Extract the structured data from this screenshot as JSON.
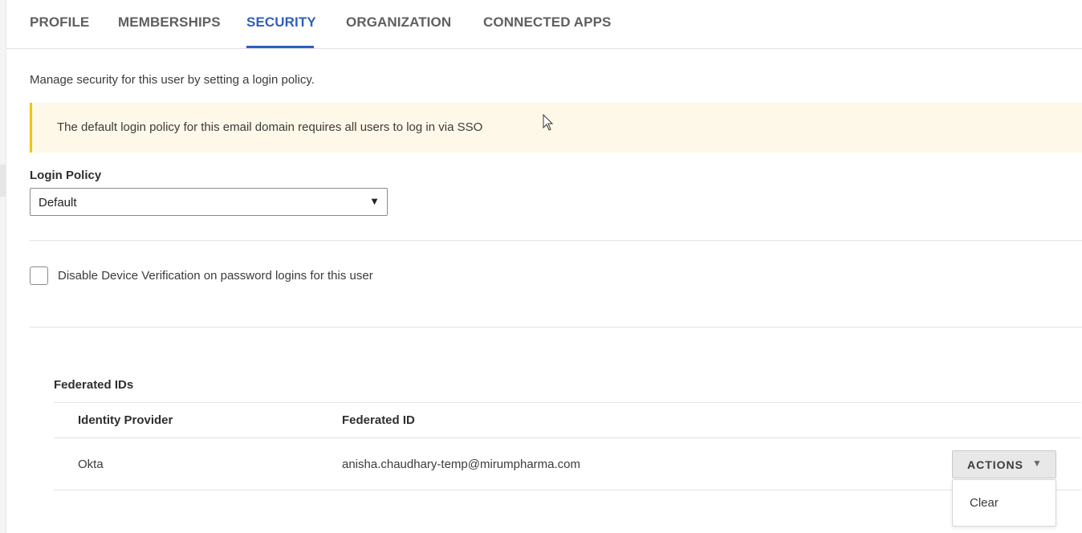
{
  "tabs": {
    "profile": "PROFILE",
    "memberships": "MEMBERSHIPS",
    "security": "SECURITY",
    "organization": "ORGANIZATION",
    "connected_apps": "CONNECTED APPS",
    "active": "SECURITY"
  },
  "security": {
    "intro": "Manage security for this user by setting a login policy.",
    "banner_text": "The default login policy for this email domain requires all users to log in via SSO",
    "login_policy_label": "Login Policy",
    "login_policy_value": "Default",
    "device_verification_label": "Disable Device Verification on password logins for this user",
    "device_verification_checked": false
  },
  "federated": {
    "title": "Federated IDs",
    "columns": [
      "Identity Provider",
      "Federated ID"
    ],
    "rows": [
      {
        "provider": "Okta",
        "federated_id": "anisha.chaudhary-temp@mirumpharma.com"
      }
    ],
    "actions_label": "ACTIONS",
    "menu_items": [
      "Clear"
    ]
  },
  "colors": {
    "accent": "#2f5fbe",
    "banner_bg": "#fdf8e7",
    "banner_border": "#f0c419"
  },
  "icons": {
    "select_caret": "caret-down-icon",
    "actions_caret": "caret-down-icon",
    "cursor": "mouse-pointer-icon"
  }
}
